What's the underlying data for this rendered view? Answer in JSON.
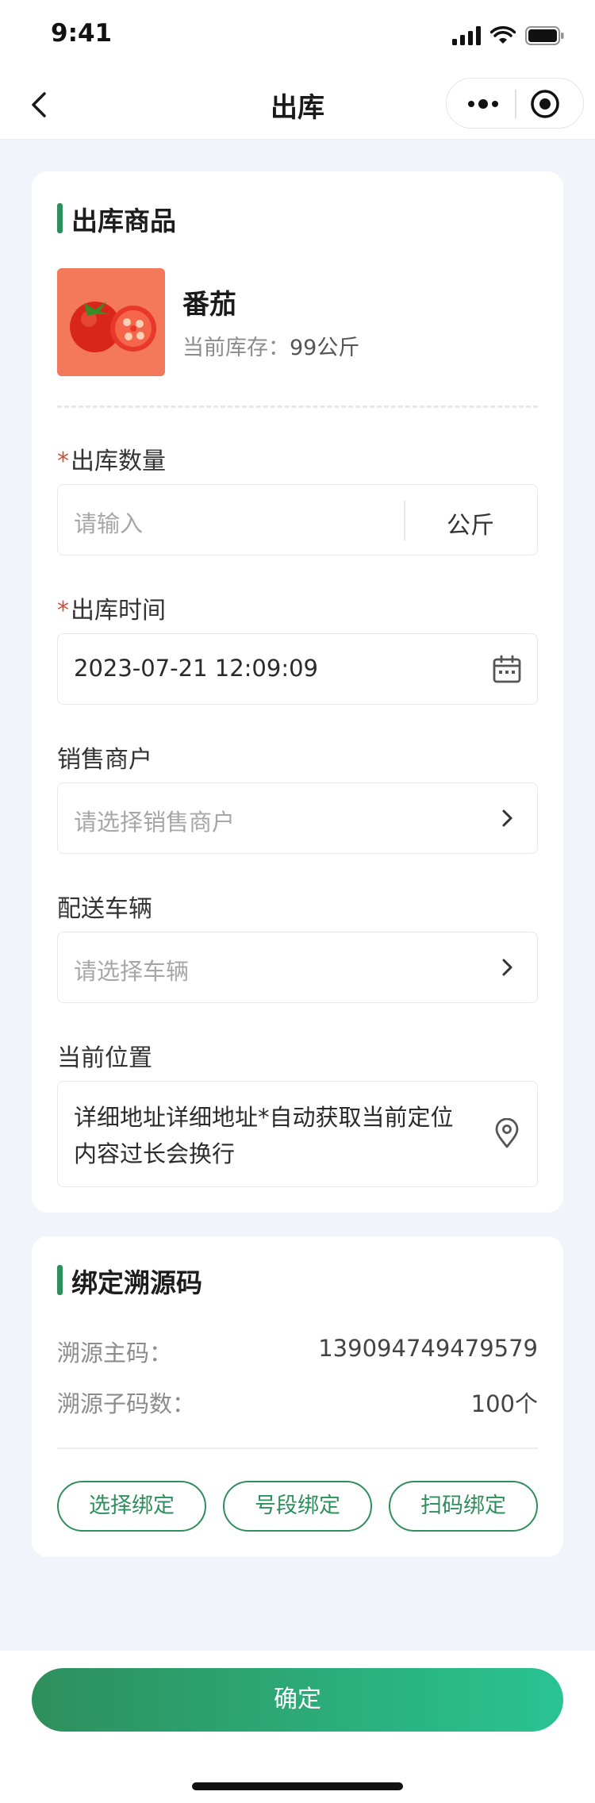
{
  "status_bar": {
    "time": "9:41"
  },
  "nav": {
    "title": "出库"
  },
  "product_section": {
    "title": "出库商品",
    "product_name": "番茄",
    "stock_label": "当前库存：",
    "stock_value": "99公斤"
  },
  "form": {
    "required_mark": "*",
    "quantity": {
      "label": "出库数量",
      "placeholder": "请输入",
      "unit": "公斤"
    },
    "time": {
      "label": "出库时间",
      "value": "2023-07-21 12:09:09"
    },
    "merchant": {
      "label": "销售商户",
      "placeholder": "请选择销售商户"
    },
    "vehicle": {
      "label": "配送车辆",
      "placeholder": "请选择车辆"
    },
    "location": {
      "label": "当前位置",
      "value": "详细地址详细地址*自动获取当前定位内容过长会换行"
    }
  },
  "trace_section": {
    "title": "绑定溯源码",
    "main_code_label": "溯源主码：",
    "main_code_value": "139094749479579",
    "sub_count_label": "溯源子码数：",
    "sub_count_value": "100个",
    "buttons": [
      "选择绑定",
      "号段绑定",
      "扫码绑定"
    ]
  },
  "footer": {
    "confirm_label": "确定"
  },
  "colors": {
    "accent": "#2e8f5c",
    "accent_end": "#29c492",
    "required": "#c4553f"
  },
  "icons": [
    "back-arrow-icon",
    "more-dots-icon",
    "target-close-icon",
    "calendar-icon",
    "chevron-right-icon",
    "location-pin-icon",
    "signal-icon",
    "wifi-icon",
    "battery-icon"
  ]
}
